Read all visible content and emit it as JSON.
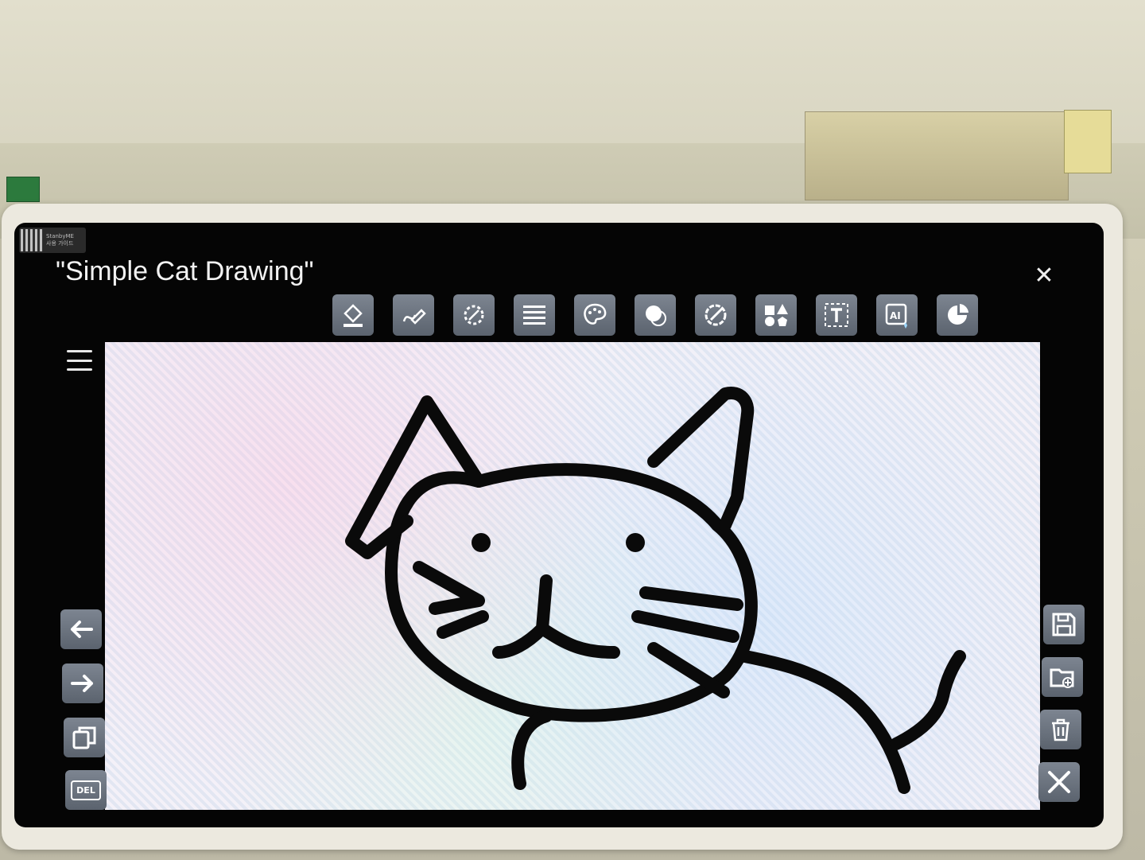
{
  "app": {
    "title": "\"Simple Cat Drawing\"",
    "qr_badge": {
      "line1": "StanbyME",
      "line2": "사용 가이드"
    }
  },
  "toolbar": {
    "tools": [
      {
        "icon": "fill-bucket-icon"
      },
      {
        "icon": "pen-icon"
      },
      {
        "icon": "brush-settings-icon"
      },
      {
        "icon": "lines-icon"
      },
      {
        "icon": "palette-icon"
      },
      {
        "icon": "eraser-icon"
      },
      {
        "icon": "color-picker-icon"
      },
      {
        "icon": "shapes-icon"
      },
      {
        "icon": "text-icon"
      },
      {
        "icon": "ai-icon"
      },
      {
        "icon": "pie-chart-icon"
      }
    ]
  },
  "left_controls": {
    "undo_icon": "arrow-left-icon",
    "redo_icon": "arrow-right-icon",
    "copy_icon": "copy-icon",
    "delete_label": "DEL"
  },
  "right_controls": {
    "save_icon": "save-icon",
    "open_icon": "folder-add-icon",
    "trash_icon": "trash-icon",
    "exit_icon": "close-icon"
  },
  "colors": {
    "screen_bg": "#050505",
    "button_bg": "#6a727d",
    "stroke": "#0a0a0a"
  }
}
